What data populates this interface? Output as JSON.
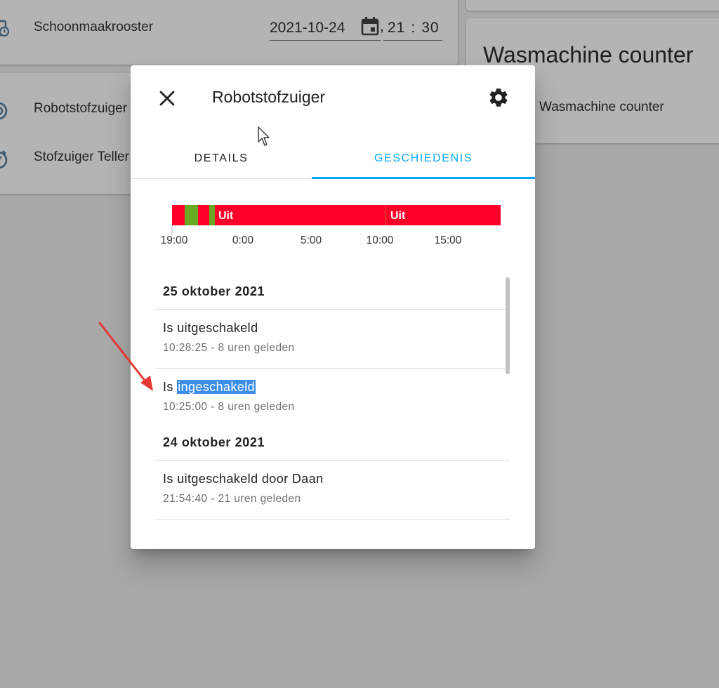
{
  "background": {
    "entities": [
      {
        "name": "Schoonmaakrooster",
        "icon": "calendar-clock-icon"
      },
      {
        "name": "Robotstofzuiger",
        "icon": "robot-vacuum-icon"
      },
      {
        "name": "Stofzuiger Teller",
        "icon": "timer-icon"
      },
      {
        "name": "Wasmachine counter",
        "icon": "counter-icon"
      }
    ],
    "datetime": {
      "date": "2021-10-24",
      "hour": "21",
      "minute": "30",
      "separator": ","
    },
    "card_title": "Wasmachine counter"
  },
  "dialog": {
    "title": "Robotstofzuiger",
    "close_icon": "close-icon",
    "settings_icon": "gear-icon",
    "tabs": [
      {
        "label": "DETAILS",
        "active": false
      },
      {
        "label": "GESCHIEDENIS",
        "active": true
      }
    ],
    "colors": {
      "accent": "#03a9f4",
      "off": "#ff0029",
      "on": "#69a821"
    },
    "timeline": {
      "ticks": [
        "19:00",
        "0:00",
        "5:00",
        "10:00",
        "15:00"
      ],
      "segment_labels": [
        "Uit",
        "Uit"
      ]
    },
    "history": [
      {
        "date": "25 oktober 2021",
        "entries": [
          {
            "message": "Is uitgeschakeld",
            "time": "10:28:25 - 8 uren geleden"
          },
          {
            "message_prefix": "Is ",
            "message_selected": "ingeschakeld",
            "time": "10:25:00 - 8 uren geleden"
          }
        ]
      },
      {
        "date": "24 oktober 2021",
        "entries": [
          {
            "message": "Is uitgeschakeld door Daan",
            "time": "21:54:40 - 21 uren geleden"
          }
        ]
      }
    ]
  }
}
